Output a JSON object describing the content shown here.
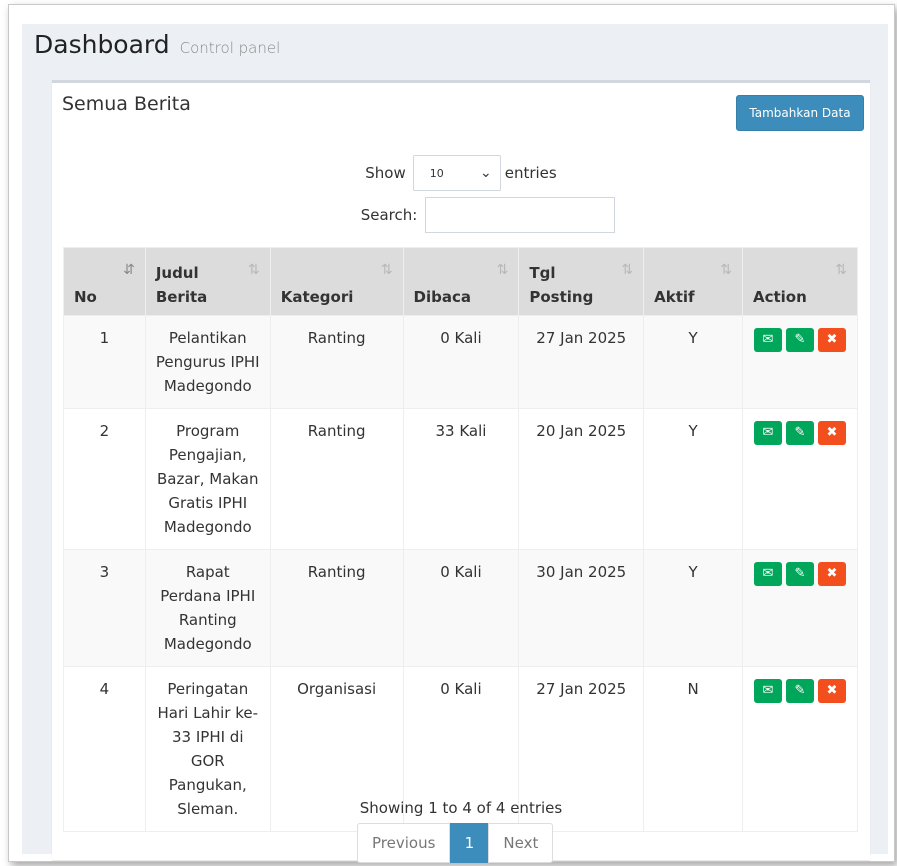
{
  "header": {
    "title": "Dashboard",
    "subtitle": "Control panel"
  },
  "box": {
    "title": "Semua Berita",
    "add_button": "Tambahkan Data"
  },
  "length": {
    "show_label": "Show",
    "selected": "10",
    "entries_label": "entries"
  },
  "search": {
    "label": "Search:",
    "value": ""
  },
  "table": {
    "columns": [
      {
        "line1": "",
        "line2": "No"
      },
      {
        "line1": "Judul",
        "line2": "Berita"
      },
      {
        "line1": "",
        "line2": "Kategori"
      },
      {
        "line1": "",
        "line2": "Dibaca"
      },
      {
        "line1": "Tgl",
        "line2": "Posting"
      },
      {
        "line1": "",
        "line2": "Aktif"
      },
      {
        "line1": "",
        "line2": "Action"
      }
    ],
    "rows": [
      {
        "no": "1",
        "judul": "Pelantikan Pengurus IPHI Madegondo",
        "kategori": "Ranting",
        "dibaca": "0 Kali",
        "tgl": "27 Jan 2025",
        "aktif": "Y"
      },
      {
        "no": "2",
        "judul": "Program Pengajian, Bazar, Makan Gratis IPHI Madegondo",
        "kategori": "Ranting",
        "dibaca": "33 Kali",
        "tgl": "20 Jan 2025",
        "aktif": "Y"
      },
      {
        "no": "3",
        "judul": "Rapat Perdana IPHI Ranting Madegondo",
        "kategori": "Ranting",
        "dibaca": "0 Kali",
        "tgl": "30 Jan 2025",
        "aktif": "Y"
      },
      {
        "no": "4",
        "judul": "Peringatan Hari Lahir ke-33 IPHI di GOR Pangukan, Sleman.",
        "kategori": "Organisasi",
        "dibaca": "0 Kali",
        "tgl": "27 Jan 2025",
        "aktif": "N"
      }
    ]
  },
  "footer": {
    "info": "Showing 1 to 4 of 4 entries",
    "previous": "Previous",
    "current_page": "1",
    "next": "Next"
  },
  "icons": {
    "sort_active": "sort-amount-asc-icon",
    "sort": "sort-icon",
    "action_1": "envelope-icon",
    "action_2": "edit-icon",
    "action_3": "close-icon"
  },
  "colors": {
    "primary": "#3c8dbc",
    "success": "#00a65a",
    "danger": "#f24e1e",
    "header_bg": "#dcdcdc"
  }
}
